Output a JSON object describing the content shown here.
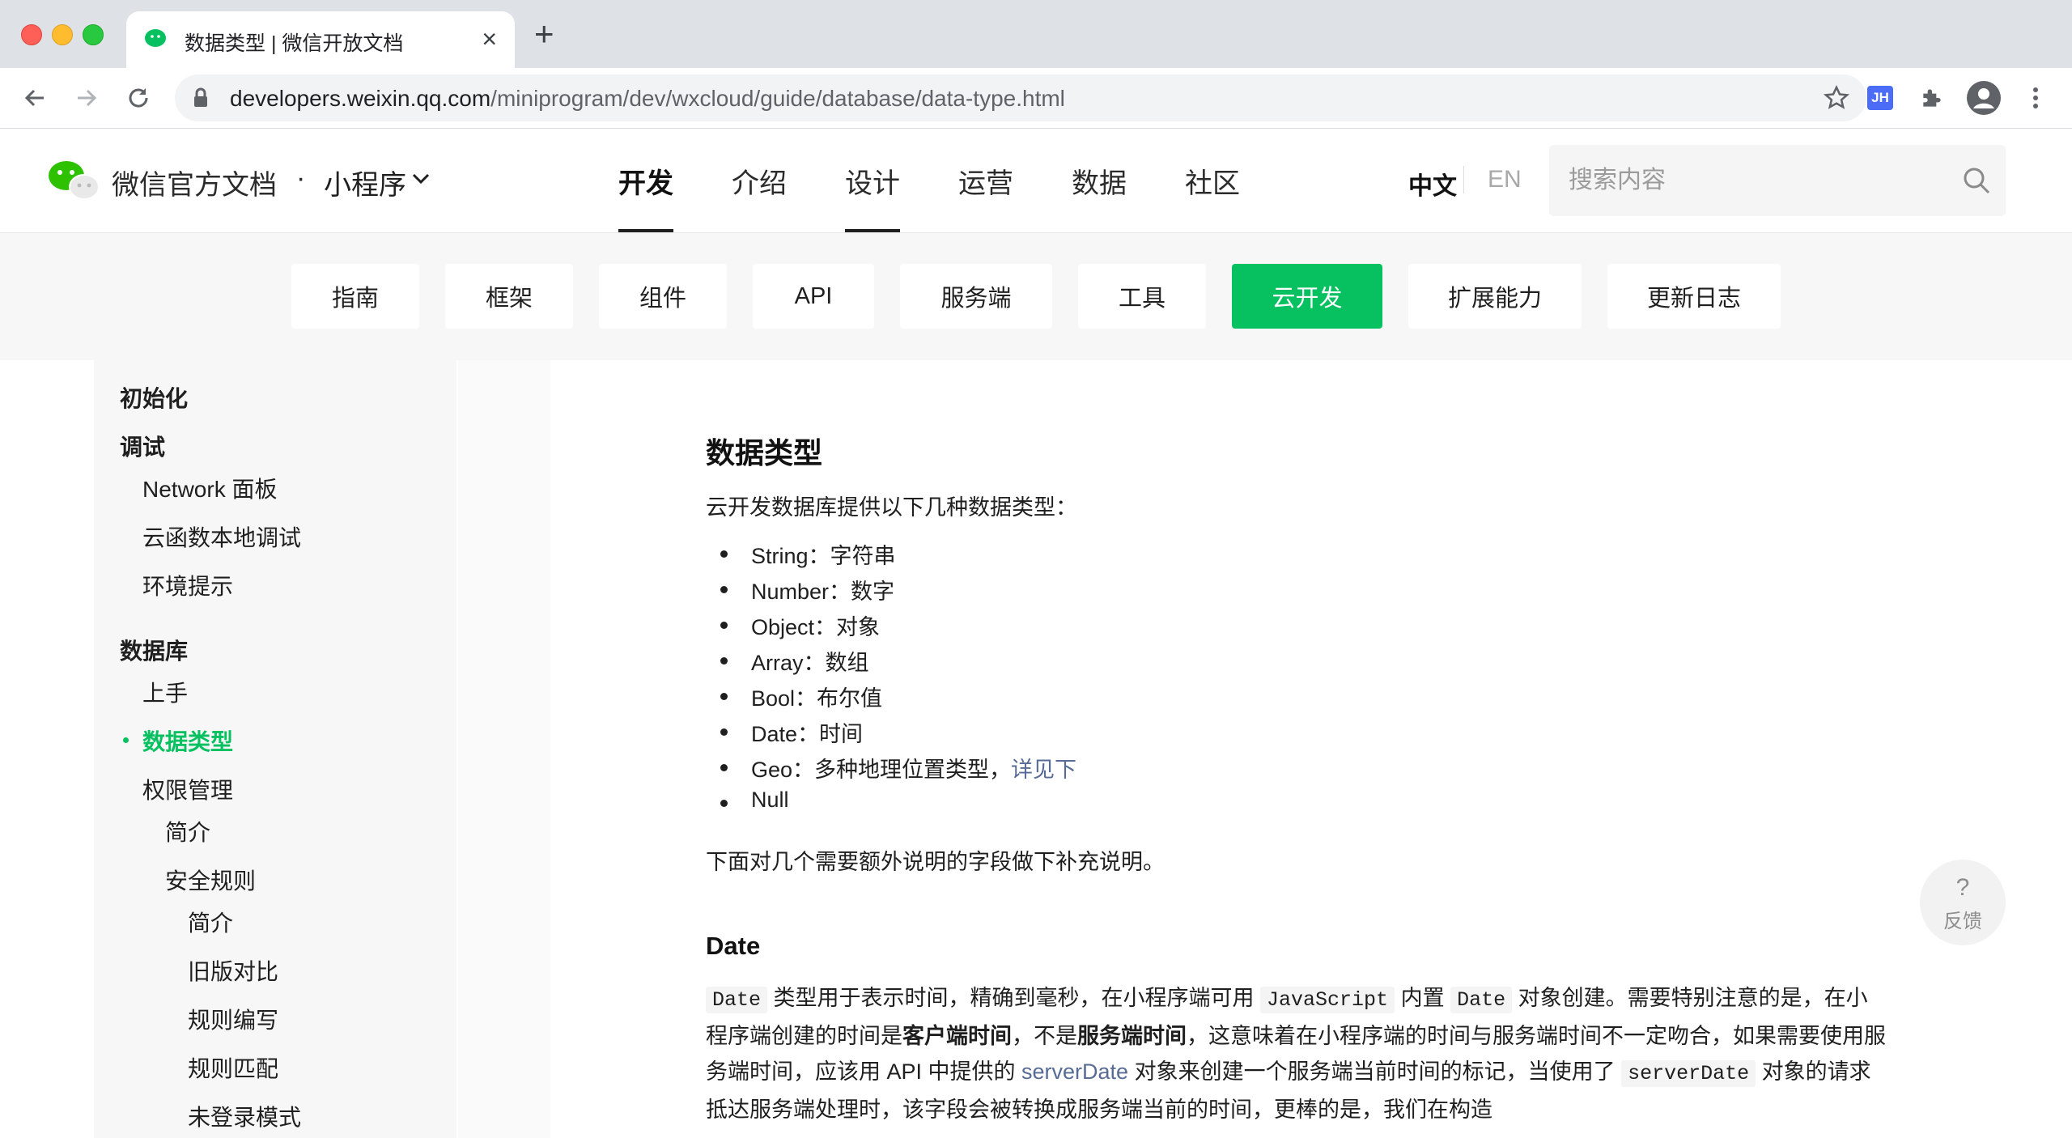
{
  "browser": {
    "tab_title": "数据类型 | 微信开放文档",
    "url_host": "developers.weixin.qq.com",
    "url_path": "/miniprogram/dev/wxcloud/guide/database/data-type.html",
    "extension_label": "JH"
  },
  "header": {
    "brand": "微信官方文档",
    "dot": "·",
    "product": "小程序",
    "nav": [
      {
        "label": "开发",
        "active": true
      },
      {
        "label": "介绍"
      },
      {
        "label": "设计"
      },
      {
        "label": "运营"
      },
      {
        "label": "数据"
      },
      {
        "label": "社区"
      }
    ],
    "lang_zh": "中文",
    "lang_en": "EN",
    "search_placeholder": "搜索内容"
  },
  "subnav": [
    "指南",
    "框架",
    "组件",
    "API",
    "服务端",
    "工具",
    "云开发",
    "扩展能力",
    "更新日志"
  ],
  "subnav_active": "云开发",
  "sidebar": {
    "items": [
      {
        "label": "初始化",
        "level": 0,
        "group": true
      },
      {
        "label": "调试",
        "level": 0,
        "group": true
      },
      {
        "label": "Network 面板",
        "level": 1
      },
      {
        "label": "云函数本地调试",
        "level": 1
      },
      {
        "label": "环境提示",
        "level": 1
      },
      {
        "label": "数据库",
        "level": 0,
        "group": true
      },
      {
        "label": "上手",
        "level": 1
      },
      {
        "label": "数据类型",
        "level": 1,
        "active": true
      },
      {
        "label": "权限管理",
        "level": 1
      },
      {
        "label": "简介",
        "level": 2
      },
      {
        "label": "安全规则",
        "level": 2
      },
      {
        "label": "简介",
        "level": 3
      },
      {
        "label": "旧版对比",
        "level": 3
      },
      {
        "label": "规则编写",
        "level": 3
      },
      {
        "label": "规则匹配",
        "level": 3
      },
      {
        "label": "未登录模式",
        "level": 3
      }
    ]
  },
  "content": {
    "title": "数据类型",
    "intro": "云开发数据库提供以下几种数据类型：",
    "types": [
      {
        "name": "String",
        "desc": "字符串"
      },
      {
        "name": "Number",
        "desc": "数字"
      },
      {
        "name": "Object",
        "desc": "对象"
      },
      {
        "name": "Array",
        "desc": "数组"
      },
      {
        "name": "Bool",
        "desc": "布尔值"
      },
      {
        "name": "Date",
        "desc": "时间"
      },
      {
        "name": "Geo",
        "desc": "多种地理位置类型，",
        "link": "详见下"
      },
      {
        "name": "Null",
        "desc": ""
      }
    ],
    "sep": "：",
    "after_list": "下面对几个需要额外说明的字段做下补充说明。",
    "date_heading": "Date",
    "date_para": {
      "code1": "Date",
      "t1": " 类型用于表示时间，精确到毫秒，在小程序端可用 ",
      "code2": "JavaScript",
      "t2": " 内置 ",
      "code3": "Date",
      "t3": " 对象创建。需要特别注意的是，在小程序端创建的时间是",
      "b1": "客户端时间",
      "t4": "，不是",
      "b2": "服务端时间",
      "t5": "，这意味着在小程序端的时间与服务端时间不一定吻合，如果需要使用服务端时间，应该用 API 中提供的 ",
      "link": "serverDate",
      "t6": " 对象来创建一个服务端当前时间的标记，当使用了 ",
      "code4": "serverDate",
      "t7": " 对象的请求抵达服务端处理时，该字段会被转换成服务端当前的时间，更棒的是，我们在构造"
    }
  },
  "feedback": {
    "icon_text": "?",
    "label": "反馈"
  },
  "colors": {
    "accent": "#07c160",
    "link": "#576b95"
  }
}
